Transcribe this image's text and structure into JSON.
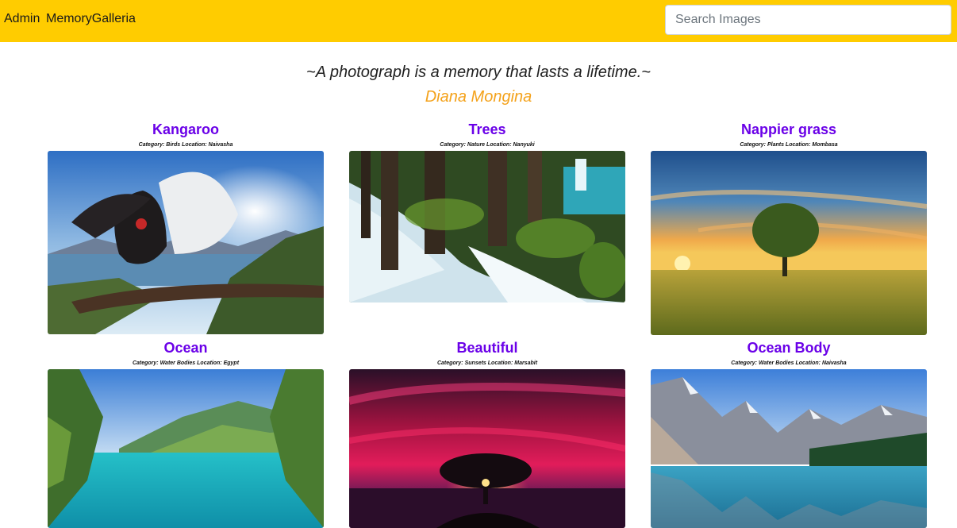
{
  "nav": {
    "admin_label": "Admin",
    "brand_label": "MemoryGalleria",
    "search_placeholder": "Search Images",
    "background_color": "#ffcc00"
  },
  "hero": {
    "quote": "~A photograph is a memory that lasts a lifetime.~",
    "author": "Diana Mongina",
    "author_color": "#f4a21b"
  },
  "meta_labels": {
    "category": "Category:",
    "location": "Location:"
  },
  "gallery": [
    {
      "title": "Kangaroo",
      "category": "Birds",
      "location": "Naivasha",
      "image_subject": "bird-spreading-wings-on-branch"
    },
    {
      "title": "Trees",
      "category": "Nature",
      "location": "Nanyuki",
      "image_subject": "forest-waterfall"
    },
    {
      "title": "Nappier grass",
      "category": "Plants",
      "location": "Mombasa",
      "image_subject": "lone-tree-sunset-field"
    },
    {
      "title": "Ocean",
      "category": "Water Bodies",
      "location": "Egypt",
      "image_subject": "turquoise-lake-valley"
    },
    {
      "title": "Beautiful",
      "category": "Sunsets",
      "location": "Marsabit",
      "image_subject": "tree-red-sky-sunset"
    },
    {
      "title": "Ocean Body",
      "category": "Water Bodies",
      "location": "Naivasha",
      "image_subject": "mountain-lake-reflection"
    }
  ],
  "colors": {
    "title": "#6a00e8",
    "quote_text": "#212121"
  }
}
